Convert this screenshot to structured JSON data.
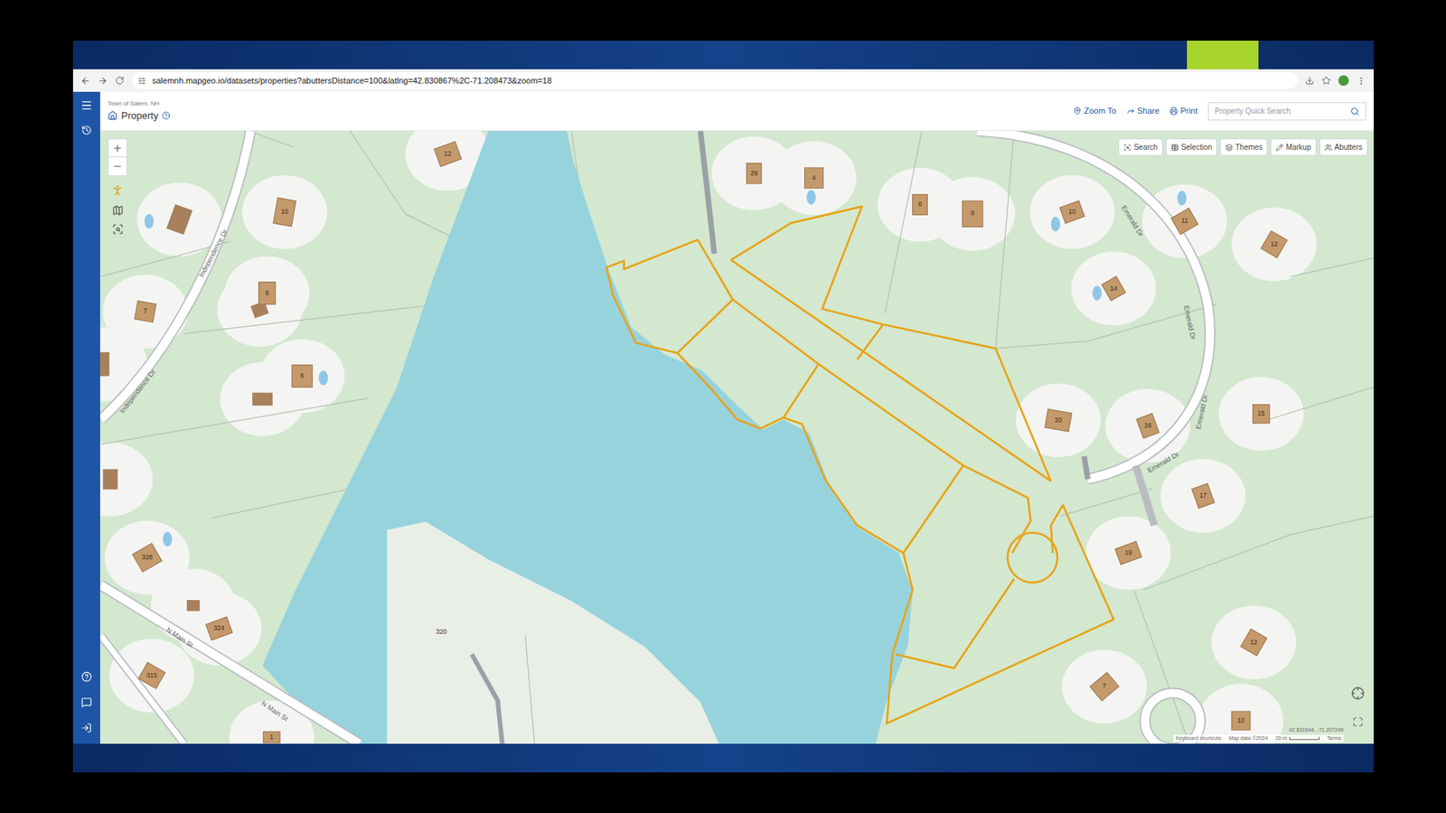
{
  "browser": {
    "url": "salemnh.mapgeo.io/datasets/properties?abuttersDistance=100&latlng=42.830867%2C-71.208473&zoom=18"
  },
  "app": {
    "town": "Town of Salem, NH",
    "title": "Property",
    "actions": [
      "Zoom To",
      "Share",
      "Print"
    ],
    "search": {
      "placeholder": "Property Quick Search"
    }
  },
  "map_tools": [
    "Search",
    "Selection",
    "Themes",
    "Markup",
    "Abutters"
  ],
  "streets": [
    "Independence Dr",
    "Independence Dr",
    "N Main St",
    "N Main St",
    "Emerald Dr",
    "Emerald Dr",
    "Emerald Dr",
    "Emerald Dr"
  ],
  "parcel_labels": [
    "12",
    "10",
    "8",
    "7",
    "6",
    "328",
    "324",
    "315",
    "1",
    "320",
    "29",
    "4",
    "6",
    "8",
    "10",
    "11",
    "12",
    "14",
    "20",
    "16",
    "15",
    "17",
    "19",
    "7",
    "12",
    "10"
  ],
  "attribution": {
    "coords": "42.831644, -71.207249",
    "shortcuts": "Keyboard shortcuts",
    "map_data": "Map data ©2024",
    "scale": "20 m",
    "terms": "Terms"
  }
}
